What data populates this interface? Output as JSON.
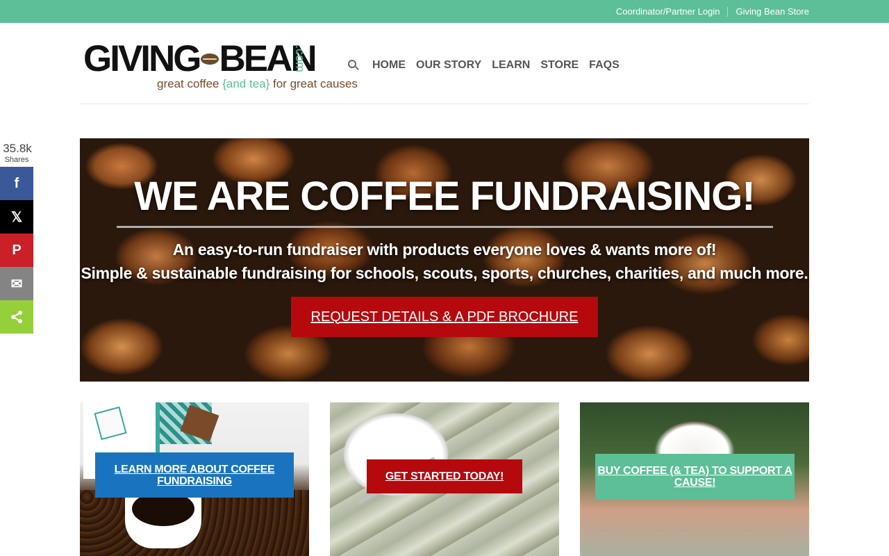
{
  "topbar": {
    "links": [
      "Coordinator/Partner Login",
      "Giving Bean Store"
    ]
  },
  "logo": {
    "main": "GIVING",
    "main2": "BEAN",
    "com": ".com",
    "tag_pre": "great coffee ",
    "tag_accent": "{and tea}",
    "tag_post": " for great causes"
  },
  "nav": {
    "items": [
      "HOME",
      "OUR STORY",
      "LEARN",
      "STORE",
      "FAQS"
    ],
    "search_icon": "search-icon"
  },
  "share": {
    "count": "35.8k",
    "label": "Shares",
    "buttons": [
      {
        "name": "facebook",
        "glyph": "f",
        "color": "#3b5998"
      },
      {
        "name": "x",
        "glyph": "𝕏",
        "color": "#000000"
      },
      {
        "name": "pinterest",
        "glyph": "P",
        "color": "#cb2027"
      },
      {
        "name": "email",
        "glyph": "✉",
        "color": "#848484"
      },
      {
        "name": "share",
        "glyph": "<",
        "color": "#95d03a"
      }
    ]
  },
  "hero": {
    "title": "WE ARE COFFEE FUNDRAISING!",
    "sub1": "An easy-to-run fundraiser with products everyone loves & wants more of!",
    "sub2": "Simple & sustainable fundraising for schools, scouts, sports, churches, charities, and much more.",
    "cta": "REQUEST DETAILS & A PDF BROCHURE"
  },
  "cards": [
    {
      "label": "LEARN MORE ABOUT COFFEE FUNDRAISING",
      "color": "#1a73bf"
    },
    {
      "label": "GET STARTED TODAY!",
      "color": "#b5090e"
    },
    {
      "label": "BUY COFFEE (& TEA) TO SUPPORT A CAUSE!",
      "color": "#5cbf97"
    }
  ],
  "colors": {
    "brand_green": "#5cbf97",
    "cta_red": "#b5090e",
    "link_blue": "#1a73bf"
  }
}
